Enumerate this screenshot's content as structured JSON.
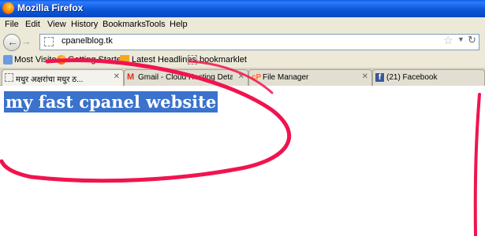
{
  "window": {
    "title": "Mozilla Firefox"
  },
  "menu": [
    "File",
    "Edit",
    "View",
    "History",
    "Bookmarks",
    "Tools",
    "Help"
  ],
  "nav": {
    "url": "cpanelblog.tk"
  },
  "bookmarks": [
    "Most Visited",
    "Getting Started",
    "Latest Headlines",
    "bookmarklet"
  ],
  "tabs": [
    {
      "label": "मधुर अक्षरांचा मधुर ठ... ",
      "active": true
    },
    {
      "label": "Gmail - Cloud Hosting Details: ...",
      "active": false
    },
    {
      "label": "File Manager",
      "active": false
    },
    {
      "label": "(21) Facebook",
      "active": false
    }
  ],
  "page": {
    "heading": "my fast cpanel website"
  },
  "colors": {
    "titlebar": "#0a5ae0",
    "selection": "#3a72cd",
    "annotation": "#f0144e",
    "chrome": "#ece9d8"
  }
}
